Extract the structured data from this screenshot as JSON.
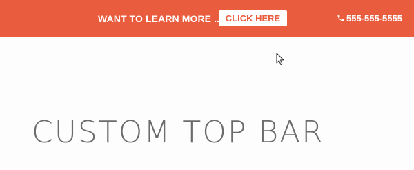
{
  "topbar": {
    "promo_text": "WANT TO LEARN MORE ...",
    "cta_label": "CLICK HERE",
    "phone_number": "555-555-5555",
    "phone_icon": "phone-icon",
    "background_color": "#e95c3e"
  },
  "cursor": {
    "icon": "mouse-pointer-icon"
  },
  "main": {
    "title": "CUSTOM TOP BAR"
  }
}
